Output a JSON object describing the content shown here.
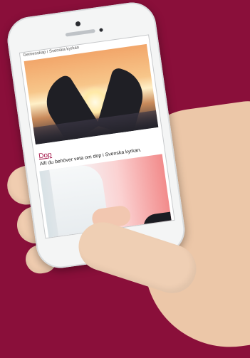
{
  "site": {
    "header_text": "Gemenskap i Svenska kyrkan"
  },
  "article": {
    "title": "Dop",
    "description": "Allt du behöver veta om dop i Svenska kyrkan."
  },
  "colors": {
    "background": "#8a0f3a",
    "accent_link": "#a31447"
  }
}
